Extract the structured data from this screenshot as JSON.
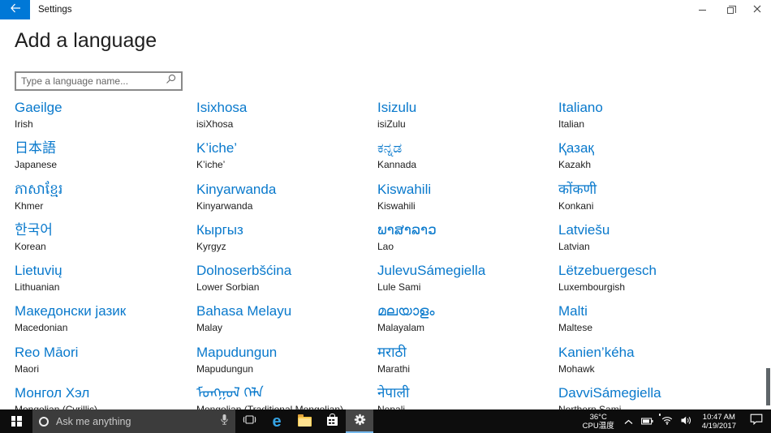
{
  "window": {
    "title": "Settings"
  },
  "page": {
    "title": "Add a language",
    "search_placeholder": "Type a language name..."
  },
  "languages": [
    {
      "native": "Gaeilge",
      "english": "Irish"
    },
    {
      "native": "Isixhosa",
      "english": "isiXhosa"
    },
    {
      "native": "Isizulu",
      "english": "isiZulu"
    },
    {
      "native": "Italiano",
      "english": "Italian"
    },
    {
      "native": "日本語",
      "english": "Japanese"
    },
    {
      "native": "K’iche’",
      "english": "K’iche’"
    },
    {
      "native": "ಕನ್ನಡ",
      "english": "Kannada"
    },
    {
      "native": "Қазақ",
      "english": "Kazakh"
    },
    {
      "native": "ភាសាខ្មែរ",
      "english": "Khmer"
    },
    {
      "native": "Kinyarwanda",
      "english": "Kinyarwanda"
    },
    {
      "native": "Kiswahili",
      "english": "Kiswahili"
    },
    {
      "native": "कोंकणी",
      "english": "Konkani"
    },
    {
      "native": "한국어",
      "english": "Korean"
    },
    {
      "native": "Кыргыз",
      "english": "Kyrgyz"
    },
    {
      "native": "ພາສາລາວ",
      "english": "Lao"
    },
    {
      "native": "Latviešu",
      "english": "Latvian"
    },
    {
      "native": "Lietuvių",
      "english": "Lithuanian"
    },
    {
      "native": "Dolnoserbšćina",
      "english": "Lower Sorbian"
    },
    {
      "native": "JulevuSámegiella",
      "english": "Lule Sami"
    },
    {
      "native": "Lëtzebuergesch",
      "english": "Luxembourgish"
    },
    {
      "native": "Македонски јазик",
      "english": "Macedonian"
    },
    {
      "native": "Bahasa Melayu",
      "english": "Malay"
    },
    {
      "native": "മലയാളം",
      "english": "Malayalam"
    },
    {
      "native": "Malti",
      "english": "Maltese"
    },
    {
      "native": "Reo Māori",
      "english": "Maori"
    },
    {
      "native": "Mapudungun",
      "english": "Mapudungun"
    },
    {
      "native": "मराठी",
      "english": "Marathi"
    },
    {
      "native": "Kanien’kéha",
      "english": "Mohawk"
    },
    {
      "native": "Монгол Хэл",
      "english": "Mongolian (Cyrillic)"
    },
    {
      "native": "ᠮᠣᠩᠭᠣᠯ ᠬᠡᠯᠡ",
      "english": "Mongolian (Traditional Mongolian)"
    },
    {
      "native": "नेपाली",
      "english": "Nepali"
    },
    {
      "native": "DavviSámegiella",
      "english": "Northern Sami"
    }
  ],
  "taskbar": {
    "search_placeholder": "Ask me anything",
    "icons": {
      "edge_glyph": "e"
    },
    "tray": {
      "temp_value": "36°C",
      "temp_label": "CPU温度",
      "time": "10:47 AM",
      "date": "4/19/2017"
    }
  },
  "colors": {
    "accent": "#0078D7",
    "link_blue": "#0979CC",
    "taskbar_underline": "#76B9ED"
  }
}
